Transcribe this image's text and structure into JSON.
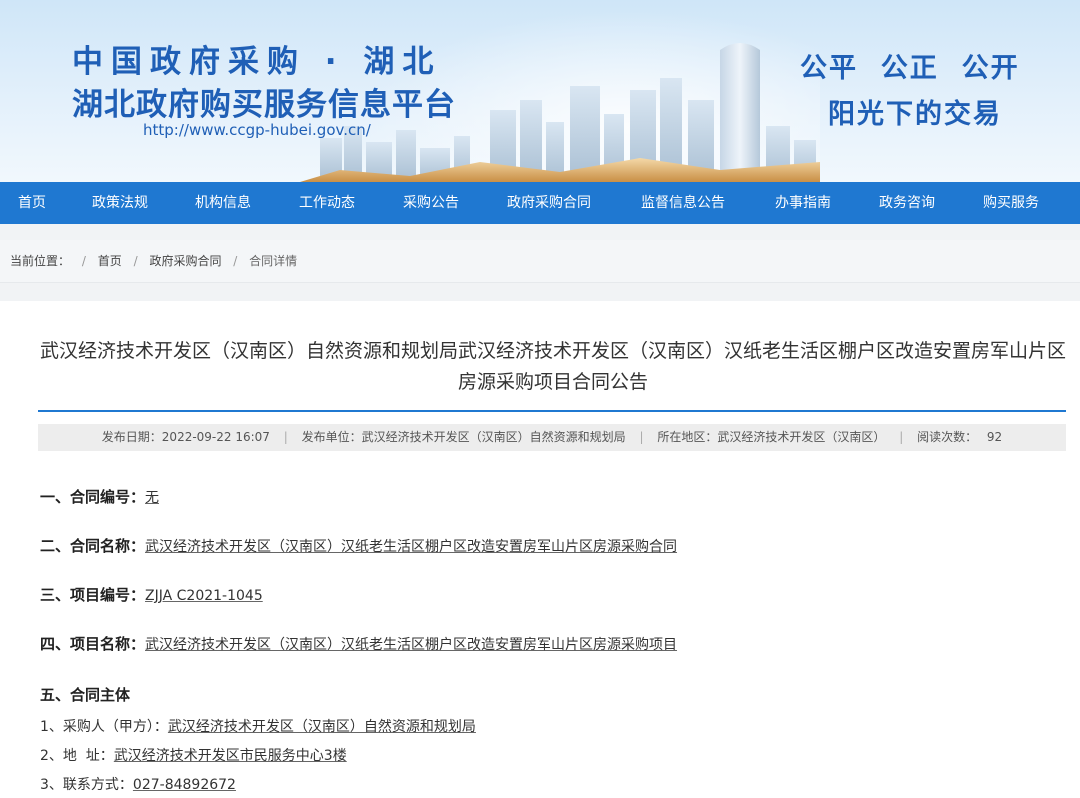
{
  "header": {
    "site_line1": "中国政府采购 · 湖北",
    "site_line2": "湖北政府购买服务信息平台",
    "site_url": "http://www.ccgp-hubei.gov.cn/",
    "slogan_line1": "公平  公正  公开",
    "slogan_line2": "阳光下的交易"
  },
  "nav": {
    "items": [
      "首页",
      "政策法规",
      "机构信息",
      "工作动态",
      "采购公告",
      "政府采购合同",
      "监督信息公告",
      "办事指南",
      "政务咨询",
      "购买服务"
    ]
  },
  "breadcrumb": {
    "prefix": "当前位置：",
    "items": [
      "首页",
      "政府采购合同",
      "合同详情"
    ]
  },
  "article": {
    "title": "武汉经济技术开发区（汉南区）自然资源和规划局武汉经济技术开发区（汉南区）汉纸老生活区棚户区改造安置房军山片区房源采购项目合同公告",
    "meta": {
      "publish_date": "发布日期：2022-09-22 16:07",
      "publisher": "发布单位：武汉经济技术开发区（汉南区）自然资源和规划局",
      "region": "所在地区：武汉经济技术开发区（汉南区）",
      "views_label": "阅读次数：",
      "views": "92"
    },
    "sections": [
      {
        "label": "一、合同编号：",
        "value": "无"
      },
      {
        "label": "二、合同名称：",
        "value": "武汉经济技术开发区（汉南区）汉纸老生活区棚户区改造安置房军山片区房源采购合同"
      },
      {
        "label": "三、项目编号：",
        "value": "ZJJA C2021-1045"
      },
      {
        "label": "四、项目名称：",
        "value": "武汉经济技术开发区（汉南区）汉纸老生活区棚户区改造安置房军山片区房源采购项目"
      }
    ],
    "section5_title": "五、合同主体",
    "section5_items": [
      {
        "label": "1、采购人（甲方）：",
        "value": "武汉经济技术开发区（汉南区）自然资源和规划局"
      },
      {
        "label": "2、地  址：",
        "value": "武汉经济技术开发区市民服务中心3楼"
      },
      {
        "label": "3、联系方式：",
        "value": "027-84892672"
      }
    ]
  },
  "colors": {
    "brand_blue": "#1f5fb6",
    "nav_blue": "#1f78d1",
    "meta_bg": "#ededed"
  }
}
